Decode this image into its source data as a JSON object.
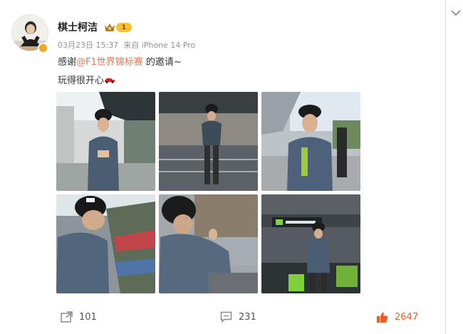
{
  "post": {
    "author": "棋士柯洁",
    "level_badge": "1",
    "meta": {
      "date": "03月23日 15:37",
      "source": "来自 iPhone 14 Pro"
    },
    "text_line1_prefix": "感谢",
    "mention": "@F1世界锦标赛",
    "text_line1_suffix": " 的邀请~",
    "text_line2": "玩得很开心",
    "text_line2_emoji": "race-car-icon"
  },
  "photos": [
    {
      "name": "photo-1",
      "icon": "photo"
    },
    {
      "name": "photo-2",
      "icon": "photo"
    },
    {
      "name": "photo-3",
      "icon": "photo"
    },
    {
      "name": "photo-4",
      "icon": "photo"
    },
    {
      "name": "photo-5",
      "icon": "photo"
    },
    {
      "name": "photo-6",
      "icon": "photo"
    }
  ],
  "actions": {
    "repost_count": "101",
    "comment_count": "231",
    "like_count": "2647"
  },
  "colors": {
    "mention": "#eb7350",
    "like": "#f05a28",
    "meta": "#939393",
    "badge": "#f9c22d"
  }
}
